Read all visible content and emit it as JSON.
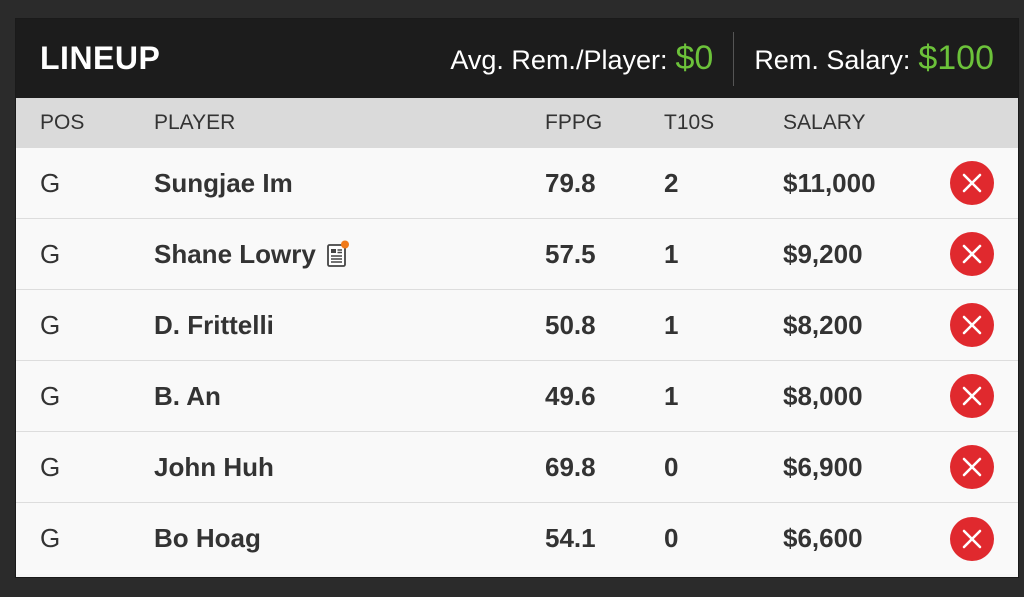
{
  "header": {
    "title": "LINEUP",
    "avg_label": "Avg. Rem./Player:",
    "avg_value": "$0",
    "rem_label": "Rem. Salary:",
    "rem_value": "$100"
  },
  "columns": {
    "pos": "POS",
    "player": "PLAYER",
    "fppg": "FPPG",
    "t10s": "T10S",
    "salary": "SALARY"
  },
  "rows": [
    {
      "pos": "G",
      "player": "Sungjae Im",
      "fppg": "79.8",
      "t10s": "2",
      "salary": "$11,000",
      "news": false
    },
    {
      "pos": "G",
      "player": "Shane Lowry",
      "fppg": "57.5",
      "t10s": "1",
      "salary": "$9,200",
      "news": true
    },
    {
      "pos": "G",
      "player": "D. Frittelli",
      "fppg": "50.8",
      "t10s": "1",
      "salary": "$8,200",
      "news": false
    },
    {
      "pos": "G",
      "player": "B. An",
      "fppg": "49.6",
      "t10s": "1",
      "salary": "$8,000",
      "news": false
    },
    {
      "pos": "G",
      "player": "John Huh",
      "fppg": "69.8",
      "t10s": "0",
      "salary": "$6,900",
      "news": false
    },
    {
      "pos": "G",
      "player": "Bo Hoag",
      "fppg": "54.1",
      "t10s": "0",
      "salary": "$6,600",
      "news": false
    }
  ],
  "colors": {
    "accent_green": "#6cc23a",
    "remove_red": "#e0292e",
    "news_dot": "#f07a1a"
  },
  "icons": {
    "remove": "close-circle-icon",
    "news": "news-document-icon"
  }
}
